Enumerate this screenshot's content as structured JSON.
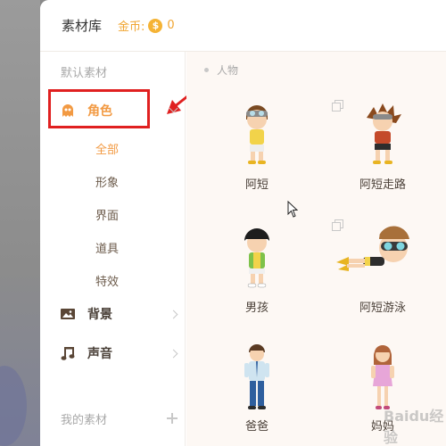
{
  "header": {
    "app_title": "素材库",
    "coin_label": "金币:",
    "coin_symbol": "$",
    "coin_count": "0"
  },
  "sidebar": {
    "default_section": "默认素材",
    "categories": [
      {
        "label": "角色",
        "icon": "ghost-icon",
        "expanded": true,
        "subitems": [
          "全部",
          "形象",
          "界面",
          "道具",
          "特效"
        ]
      },
      {
        "label": "背景",
        "icon": "image-icon"
      },
      {
        "label": "声音",
        "icon": "music-note-icon"
      }
    ],
    "my_section": "我的素材"
  },
  "content": {
    "group_title": "人物",
    "items": [
      {
        "name": "阿短"
      },
      {
        "name": "阿短走路"
      },
      {
        "name": "男孩"
      },
      {
        "name": "阿短游泳"
      },
      {
        "name": "爸爸"
      },
      {
        "name": "妈妈"
      }
    ]
  },
  "watermark": "Baidu经验",
  "colors": {
    "accent": "#f29a43",
    "coin": "#f5b335",
    "highlight": "#e02020",
    "content_bg": "#fdf8f4"
  }
}
